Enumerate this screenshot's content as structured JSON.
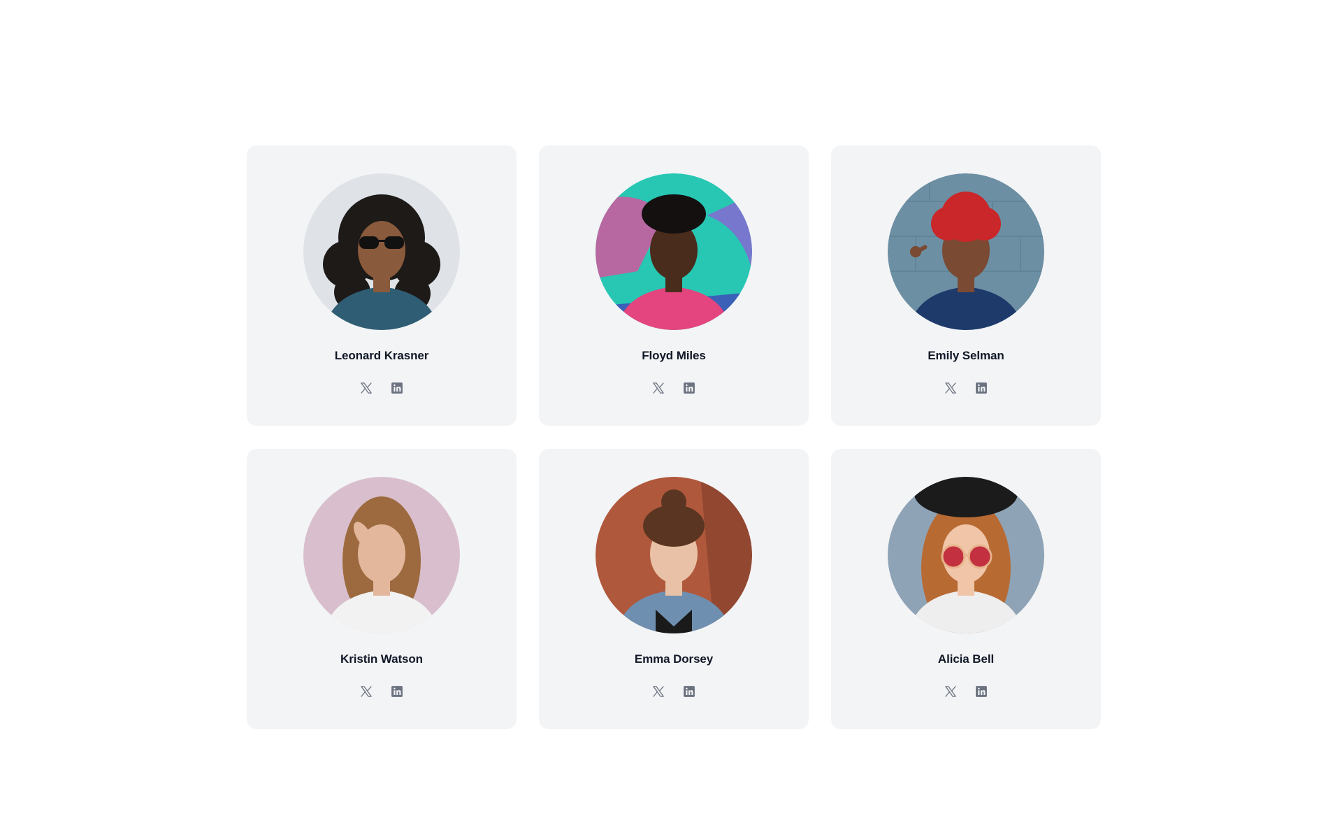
{
  "team": {
    "members": [
      {
        "name": "Leonard Krasner",
        "photo": {
          "bg": "#dfe3e8",
          "skin": "#8a5a3c",
          "hair": "#1d1a18",
          "shirt": "#2f5e74",
          "accent": "#111111",
          "hair_style": "curly"
        },
        "socials": [
          "x-icon",
          "linkedin-icon"
        ]
      },
      {
        "name": "Floyd Miles",
        "photo": {
          "bg": "#27c7b3",
          "skin": "#4a2c1d",
          "hair": "#141010",
          "shirt": "#e4457f",
          "accent": "#9a55d9",
          "hair_style": "short"
        },
        "socials": [
          "x-icon",
          "linkedin-icon"
        ]
      },
      {
        "name": "Emily Selman",
        "photo": {
          "bg": "#6c8fa3",
          "skin": "#7a4a33",
          "hair": "#c9272a",
          "shirt": "#1d3a6b",
          "accent": "#8fb0c2",
          "hair_style": "puff"
        },
        "socials": [
          "x-icon",
          "linkedin-icon"
        ]
      },
      {
        "name": "Kristin Watson",
        "photo": {
          "bg": "#d9bfcd",
          "skin": "#e3b79c",
          "hair": "#9c6a3e",
          "shirt": "#f2f2f2",
          "accent": "#cfa6bb",
          "hair_style": "long"
        },
        "socials": [
          "x-icon",
          "linkedin-icon"
        ]
      },
      {
        "name": "Emma Dorsey",
        "photo": {
          "bg": "#b0583c",
          "skin": "#e8c1a6",
          "hair": "#5a3622",
          "shirt": "#6e8fb0",
          "accent": "#1a1a1a",
          "hair_style": "bun"
        },
        "socials": [
          "x-icon",
          "linkedin-icon"
        ]
      },
      {
        "name": "Alicia Bell",
        "photo": {
          "bg": "#8ea3b5",
          "skin": "#f0c5a8",
          "hair": "#b86a33",
          "shirt": "#eeeeee",
          "accent": "#c0293a",
          "hair_style": "long-hat"
        },
        "socials": [
          "x-icon",
          "linkedin-icon"
        ]
      }
    ]
  },
  "colors": {
    "card_bg": "#f3f4f6",
    "name_text": "#111827",
    "icon": "#6b7280"
  }
}
